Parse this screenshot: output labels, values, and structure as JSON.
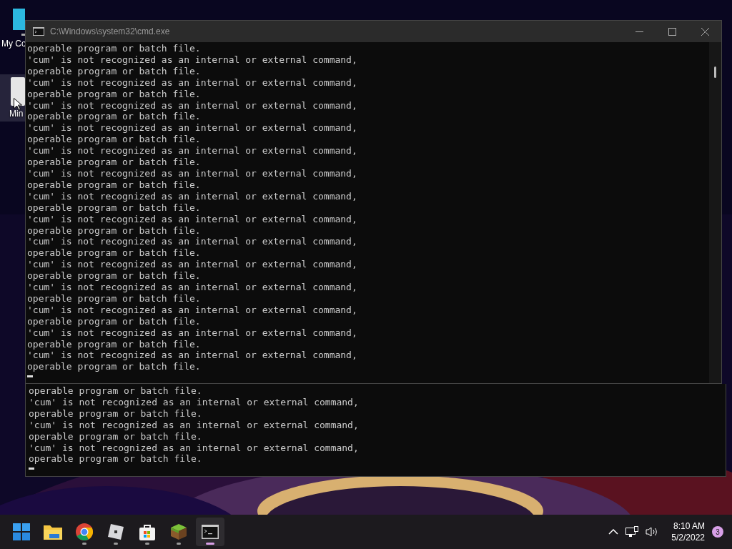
{
  "desktop_icons": [
    {
      "kind": "monitor",
      "label": "My Co",
      "selected": false
    },
    {
      "kind": "file",
      "label": "Min",
      "selected": true
    }
  ],
  "windows": [
    {
      "title": "C:\\Windows\\system32\\cmd.exe",
      "lines": [
        "operable program or batch file.",
        "'cum' is not recognized as an internal or external command,",
        "operable program or batch file.",
        "'cum' is not recognized as an internal or external command,",
        "operable program or batch file.",
        "'cum' is not recognized as an internal or external command,",
        "operable program or batch file.",
        "'cum' is not recognized as an internal or external command,",
        "operable program or batch file.",
        "'cum' is not recognized as an internal or external command,",
        "operable program or batch file.",
        "'cum' is not recognized as an internal or external command,",
        "operable program or batch file.",
        "'cum' is not recognized as an internal or external command,",
        "operable program or batch file.",
        "'cum' is not recognized as an internal or external command,",
        "operable program or batch file.",
        "'cum' is not recognized as an internal or external command,",
        "operable program or batch file.",
        "'cum' is not recognized as an internal or external command,",
        "operable program or batch file.",
        "'cum' is not recognized as an internal or external command,",
        "operable program or batch file.",
        "'cum' is not recognized as an internal or external command,",
        "operable program or batch file.",
        "'cum' is not recognized as an internal or external command,",
        "operable program or batch file.",
        "'cum' is not recognized as an internal or external command,",
        "operable program or batch file."
      ]
    },
    {
      "lines": [
        "operable program or batch file.",
        "'cum' is not recognized as an internal or external command,",
        "operable program or batch file.",
        "'cum' is not recognized as an internal or external command,",
        "operable program or batch file.",
        "'cum' is not recognized as an internal or external command,",
        "operable program or batch file."
      ]
    }
  ],
  "taskbar": {
    "apps": [
      {
        "kind": "start",
        "running": false,
        "selected": false
      },
      {
        "kind": "folder",
        "running": false,
        "selected": false
      },
      {
        "kind": "browser",
        "running": true,
        "selected": false
      },
      {
        "kind": "cube",
        "running": true,
        "selected": false
      },
      {
        "kind": "store",
        "running": true,
        "selected": false
      },
      {
        "kind": "block",
        "running": true,
        "selected": false
      },
      {
        "kind": "terminal",
        "running": true,
        "selected": true
      }
    ],
    "time": "8:10 AM",
    "date": "5/2/2022",
    "notifications": "3"
  }
}
